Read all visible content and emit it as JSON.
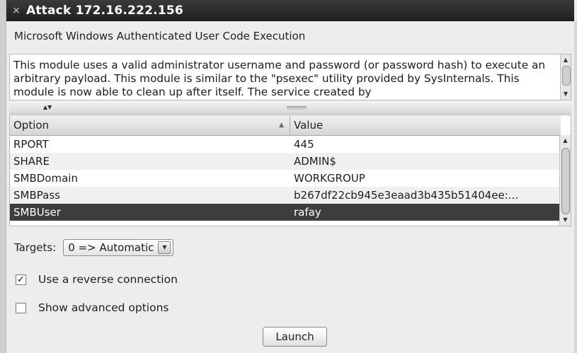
{
  "window": {
    "close_glyph": "×",
    "title": "Attack 172.16.222.156"
  },
  "module": {
    "name": "Microsoft Windows Authenticated User Code Execution",
    "description": "This module uses a valid administrator username and password (or password hash) to execute an arbitrary payload. This module is similar to the \"psexec\" utility provided by SysInternals. This module is now able to clean up after itself. The service created by"
  },
  "options_table": {
    "columns": [
      "Option",
      "Value"
    ],
    "rows": [
      {
        "option": "RPORT",
        "value": "445"
      },
      {
        "option": "SHARE",
        "value": "ADMIN$"
      },
      {
        "option": "SMBDomain",
        "value": "WORKGROUP"
      },
      {
        "option": "SMBPass",
        "value": "b267df22cb945e3eaad3b435b51404ee:..."
      },
      {
        "option": "SMBUser",
        "value": "rafay"
      }
    ],
    "selected_row": "SMBUser"
  },
  "targets": {
    "label": "Targets:",
    "selected": "0 => Automatic"
  },
  "checkboxes": {
    "reverse": {
      "label": "Use a reverse connection",
      "checked": true
    },
    "advanced": {
      "label": "Show advanced options",
      "checked": false
    }
  },
  "launch_label": "Launch",
  "colors": {
    "titlebar": "#2a2a2a",
    "selected_row": "#3d3d3d",
    "background": "#ececec"
  }
}
